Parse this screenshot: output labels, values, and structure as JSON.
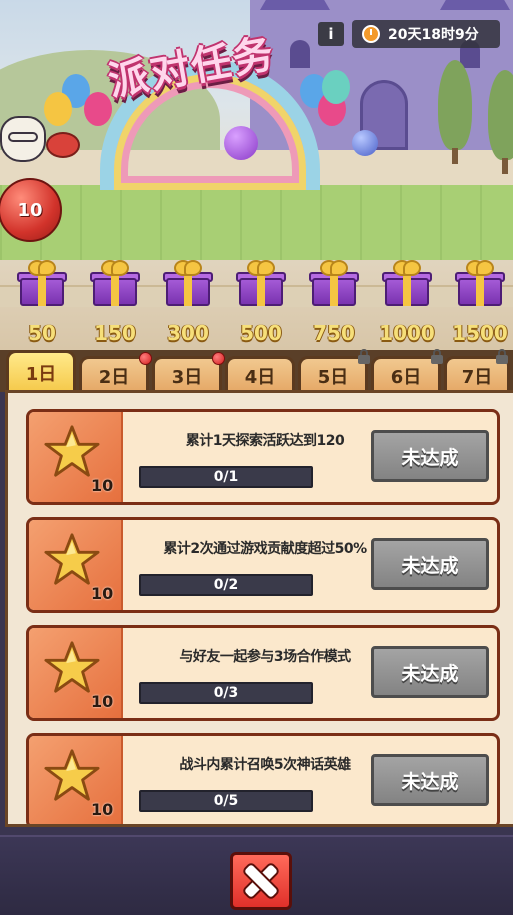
{
  "header": {
    "title": "派对任务",
    "info_label": "i",
    "countdown": "20天18时9分"
  },
  "progress_marker": {
    "points": "10"
  },
  "milestones": [
    {
      "threshold": "50"
    },
    {
      "threshold": "150"
    },
    {
      "threshold": "300"
    },
    {
      "threshold": "500"
    },
    {
      "threshold": "750"
    },
    {
      "threshold": "1000"
    },
    {
      "threshold": "1500"
    }
  ],
  "tabs": [
    {
      "label": "1日",
      "active": true,
      "badge": "none"
    },
    {
      "label": "2日",
      "active": false,
      "badge": "red-dot"
    },
    {
      "label": "3日",
      "active": false,
      "badge": "red-dot"
    },
    {
      "label": "4日",
      "active": false,
      "badge": "none"
    },
    {
      "label": "5日",
      "active": false,
      "badge": "lock"
    },
    {
      "label": "6日",
      "active": false,
      "badge": "lock"
    },
    {
      "label": "7日",
      "active": false,
      "badge": "lock"
    }
  ],
  "tasks": [
    {
      "description": "累计1天探索活跃达到120",
      "reward": "10",
      "progress_text": "0/1",
      "progress_fraction": 0,
      "status": "未达成"
    },
    {
      "description": "累计2次通过游戏贡献度超过50%",
      "reward": "10",
      "progress_text": "0/2",
      "progress_fraction": 0,
      "status": "未达成"
    },
    {
      "description": "与好友一起参与3场合作模式",
      "reward": "10",
      "progress_text": "0/3",
      "progress_fraction": 0,
      "status": "未达成"
    },
    {
      "description": "战斗内累计召唤5次神话英雄",
      "reward": "10",
      "progress_text": "0/5",
      "progress_fraction": 0,
      "status": "未达成"
    }
  ],
  "colors": {
    "active_tab": "#f5c94a",
    "tab": "#e5a866",
    "status_button": "#939393",
    "close_button": "#e0302a"
  },
  "icons": {
    "reward": "star-icon",
    "milestone": "gift-icon",
    "close": "close-icon",
    "timer": "clock-icon",
    "locked_tab": "lock-icon"
  }
}
